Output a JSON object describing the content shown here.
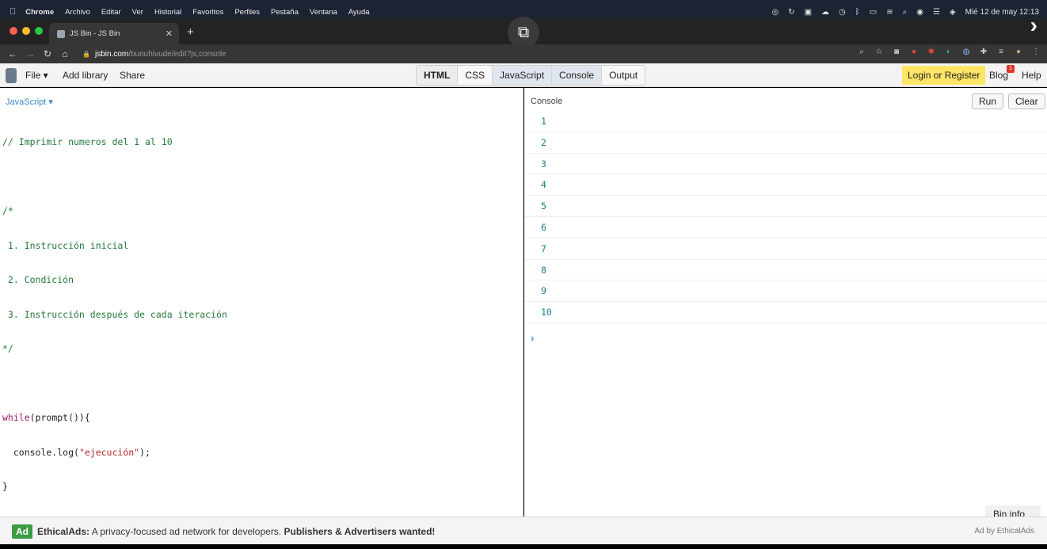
{
  "menubar": {
    "items": [
      "Chrome",
      "Archivo",
      "Editar",
      "Ver",
      "Historial",
      "Favoritos",
      "Perfiles",
      "Pestaña",
      "Ventana",
      "Ayuda"
    ],
    "datetime": "Mié 12 de may  12:13"
  },
  "browser": {
    "tab_title": "JS Bin - JS Bin",
    "url_host": "jsbin.com",
    "url_path": "/bunuhivude/edit?js,console"
  },
  "toolbar": {
    "file": "File ▾",
    "add_library": "Add library",
    "share": "Share",
    "panels": [
      "HTML",
      "CSS",
      "JavaScript",
      "Console",
      "Output"
    ],
    "login": "Login or Register",
    "blog": "Blog",
    "blog_badge": "1",
    "help": "Help"
  },
  "editor": {
    "label": "JavaScript ▾",
    "lines": [
      "// Imprimir numeros del 1 al 10",
      "",
      "/*",
      " 1. Instrucción inicial",
      " 2. Condición",
      " 3. Instrucción después de cada iteración",
      "*/",
      "",
      "while(prompt()){",
      "  console.log(\"ejecución\");",
      "}"
    ]
  },
  "console": {
    "title": "Console",
    "run": "Run",
    "clear": "Clear",
    "output": [
      "1",
      "2",
      "3",
      "4",
      "5",
      "6",
      "7",
      "8",
      "9",
      "10"
    ],
    "prompt": "›",
    "bin_info": "Bin info"
  },
  "ad": {
    "tag": "Ad",
    "brand": "EthicalAds:",
    "text": " A privacy-focused ad network for developers. ",
    "cta": "Publishers & Advertisers wanted!",
    "by": "Ad by EthicalAds"
  }
}
